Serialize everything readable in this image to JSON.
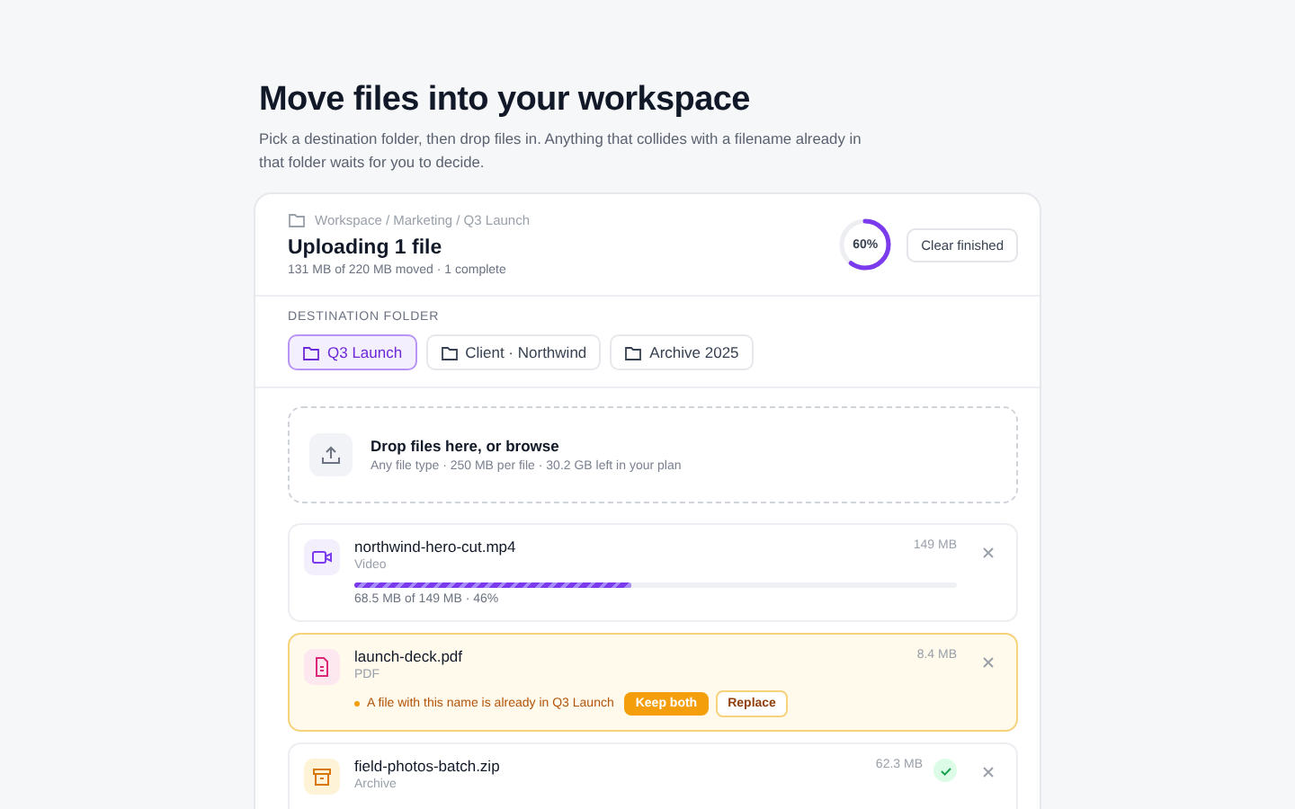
{
  "page": {
    "title": "Move files into your workspace",
    "description": "Pick a destination folder, then drop files in. Anything that collides with a filename already in that folder waits for you to decide."
  },
  "header": {
    "breadcrumb": "Workspace / Marketing / Q3 Launch",
    "title": "Uploading 1 file",
    "summary": "131 MB of 220 MB moved · 1 complete",
    "progress": {
      "label": "60%"
    },
    "clear_button": "Clear finished"
  },
  "destination": {
    "label": "DESTINATION FOLDER",
    "folders": [
      {
        "name": "Q3 Launch",
        "selected": true
      },
      {
        "name": "Client · Northwind",
        "selected": false
      },
      {
        "name": "Archive 2025",
        "selected": false
      }
    ]
  },
  "dropzone": {
    "title": "Drop files here, or browse",
    "hint": "Any file type · 250 MB per file · 30.2 GB left in your plan"
  },
  "files": [
    {
      "kind": "uploading",
      "name": "northwind-hero-cut.mp4",
      "type_label": "Video",
      "size": "149 MB",
      "level": 0.46,
      "progress_text": "68.5 MB of 149 MB · 46%"
    },
    {
      "kind": "conflict",
      "name": "launch-deck.pdf",
      "type_label": "PDF",
      "size": "8.4 MB",
      "message": "A file with this name is already in Q3 Launch",
      "primary_action": "Keep both",
      "secondary_action": "Replace"
    },
    {
      "kind": "done",
      "name": "field-photos-batch.zip",
      "type_label": "Archive",
      "size": "62.3 MB"
    }
  ]
}
